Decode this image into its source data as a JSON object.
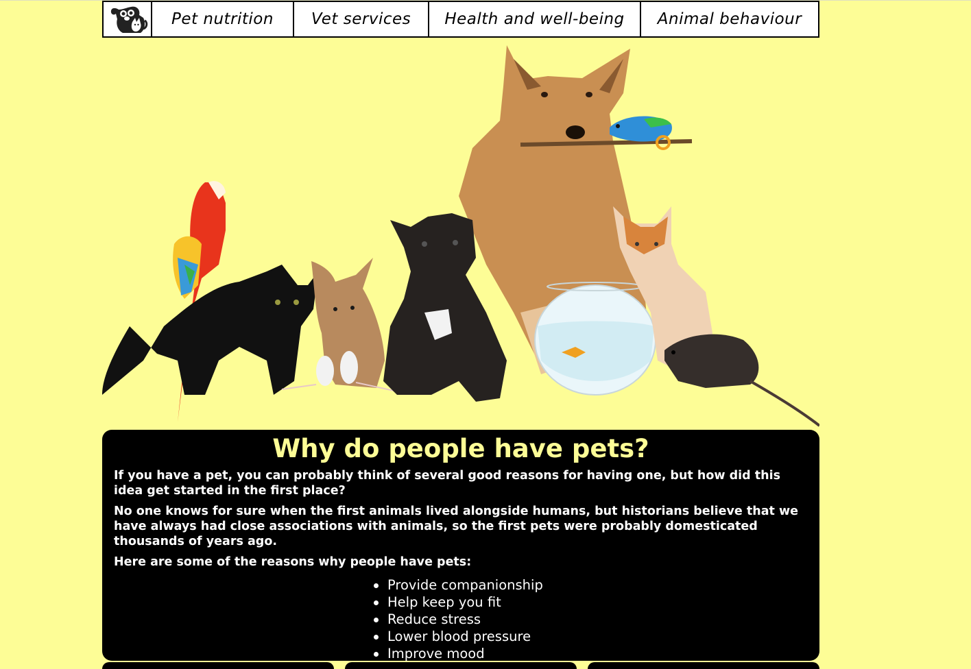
{
  "nav": {
    "logo_icon": "dog-and-cat-logo-icon",
    "items": [
      {
        "label": "Pet nutrition"
      },
      {
        "label": "Vet services"
      },
      {
        "label": "Health and well-being"
      },
      {
        "label": "Animal behaviour"
      }
    ]
  },
  "hero": {
    "icon": "pets-group-illustration"
  },
  "article": {
    "heading": "Why do people have pets?",
    "paragraphs": [
      "If you have a pet, you can probably think of several good reasons for having one, but how did this idea get started in the first place?",
      "No one knows for sure when the first animals lived alongside humans, but historians believe that we have always had close associations with animals, so the first pets were probably domesticated thousands of years ago.",
      "Here are some of the reasons why people have pets:"
    ],
    "reasons": [
      "Provide companionship",
      "Help keep you fit",
      "Reduce stress",
      "Lower blood pressure",
      "Improve mood"
    ]
  },
  "colors": {
    "background": "#fdfd96",
    "card": "#000000",
    "heading": "#fdfd96"
  }
}
